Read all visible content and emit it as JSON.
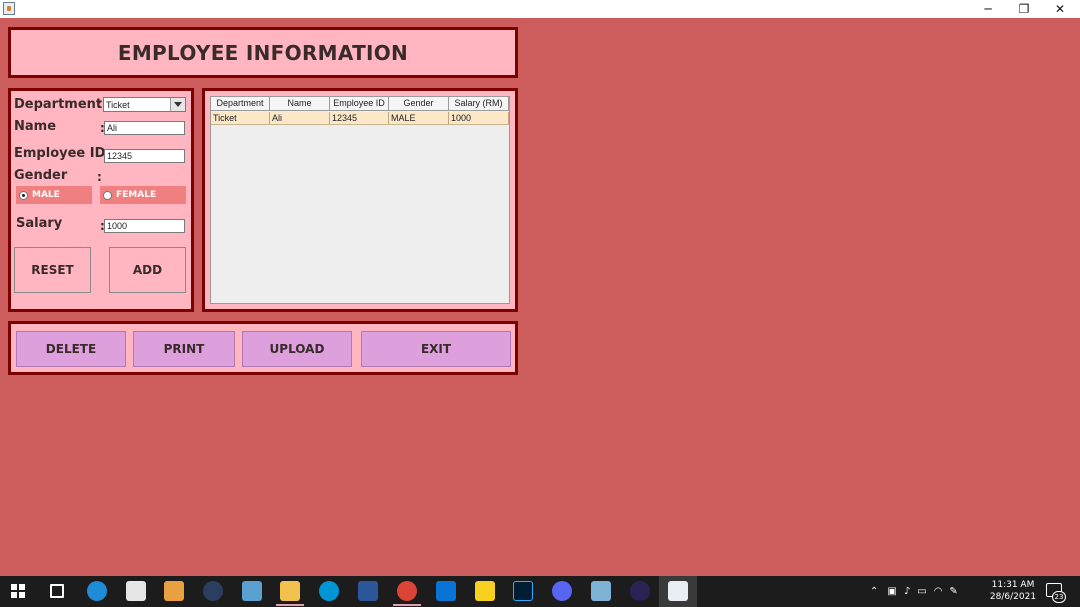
{
  "window": {
    "min_glyph": "─",
    "max_glyph": "❐",
    "close_glyph": "✕"
  },
  "header": {
    "title": "EMPLOYEE INFORMATION"
  },
  "form": {
    "department_label": "Department",
    "department_value": "Ticket",
    "name_label": "Name",
    "name_value": "Ali",
    "empid_label": "Employee ID:",
    "empid_value": "12345",
    "gender_label": "Gender",
    "gender_options": [
      {
        "label": "MALE",
        "checked": true
      },
      {
        "label": "FEMALE",
        "checked": false
      }
    ],
    "salary_label": "Salary",
    "salary_value": "1000",
    "colon": ":",
    "reset_label": "RESET",
    "add_label": "ADD"
  },
  "table": {
    "columns": [
      "Department",
      "Name",
      "Employee ID",
      "Gender",
      "Salary (RM)"
    ],
    "rows": [
      [
        "Ticket",
        "Ali",
        "12345",
        "MALE",
        "1000"
      ]
    ]
  },
  "actions": {
    "delete_label": "DELETE",
    "print_label": "PRINT",
    "upload_label": "UPLOAD",
    "exit_label": "EXIT"
  },
  "taskbar": {
    "time": "11:31 AM",
    "date": "28/6/2021",
    "notifications": "23",
    "icons": [
      "windows-start-icon",
      "task-view-icon",
      "edge-icon",
      "store-icon",
      "media-player-icon",
      "steam-icon",
      "photos-icon",
      "file-explorer-icon",
      "hp-icon",
      "word-icon",
      "chrome-icon",
      "mail-icon",
      "sticky-notes-icon",
      "photoshop-icon",
      "discord-icon",
      "notepad-icon",
      "eclipse-icon",
      "java-icon"
    ]
  },
  "colors": {
    "background": "#cd5c5c",
    "panel": "#ffb6c1",
    "border": "#7b0000",
    "action_button": "#dda0dd",
    "radio_bg": "#f08080"
  }
}
